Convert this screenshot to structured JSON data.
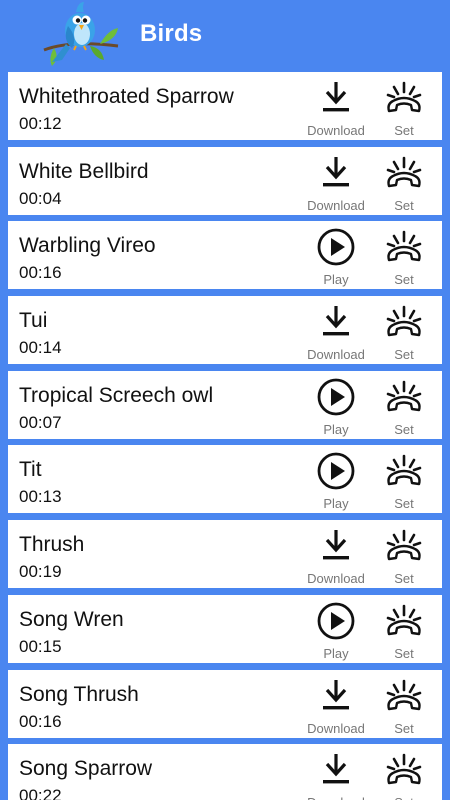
{
  "header": {
    "title": "Birds",
    "logo_icon": "bird-logo-icon"
  },
  "colors": {
    "accent": "#4a86f0",
    "card": "#ffffff",
    "text": "#111111",
    "label": "#777777"
  },
  "sounds": [
    {
      "name": "Whitethroated Sparrow",
      "duration": "00:12",
      "primary": {
        "type": "download",
        "label": "Download",
        "icon": "download-icon"
      },
      "set_label": "Set"
    },
    {
      "name": "White Bellbird",
      "duration": "00:04",
      "primary": {
        "type": "download",
        "label": "Download",
        "icon": "download-icon"
      },
      "set_label": "Set"
    },
    {
      "name": "Warbling Vireo",
      "duration": "00:16",
      "primary": {
        "type": "play",
        "label": "Play",
        "icon": "play-icon"
      },
      "set_label": "Set"
    },
    {
      "name": "Tui",
      "duration": "00:14",
      "primary": {
        "type": "download",
        "label": "Download",
        "icon": "download-icon"
      },
      "set_label": "Set"
    },
    {
      "name": "Tropical Screech owl",
      "duration": "00:07",
      "primary": {
        "type": "play",
        "label": "Play",
        "icon": "play-icon"
      },
      "set_label": "Set"
    },
    {
      "name": "Tit",
      "duration": "00:13",
      "primary": {
        "type": "play",
        "label": "Play",
        "icon": "play-icon"
      },
      "set_label": "Set"
    },
    {
      "name": "Thrush",
      "duration": "00:19",
      "primary": {
        "type": "download",
        "label": "Download",
        "icon": "download-icon"
      },
      "set_label": "Set"
    },
    {
      "name": "Song Wren",
      "duration": "00:15",
      "primary": {
        "type": "play",
        "label": "Play",
        "icon": "play-icon"
      },
      "set_label": "Set"
    },
    {
      "name": "Song Thrush",
      "duration": "00:16",
      "primary": {
        "type": "download",
        "label": "Download",
        "icon": "download-icon"
      },
      "set_label": "Set"
    },
    {
      "name": "Song Sparrow",
      "duration": "00:22",
      "primary": {
        "type": "download",
        "label": "Download",
        "icon": "download-icon"
      },
      "set_label": "Set"
    }
  ]
}
